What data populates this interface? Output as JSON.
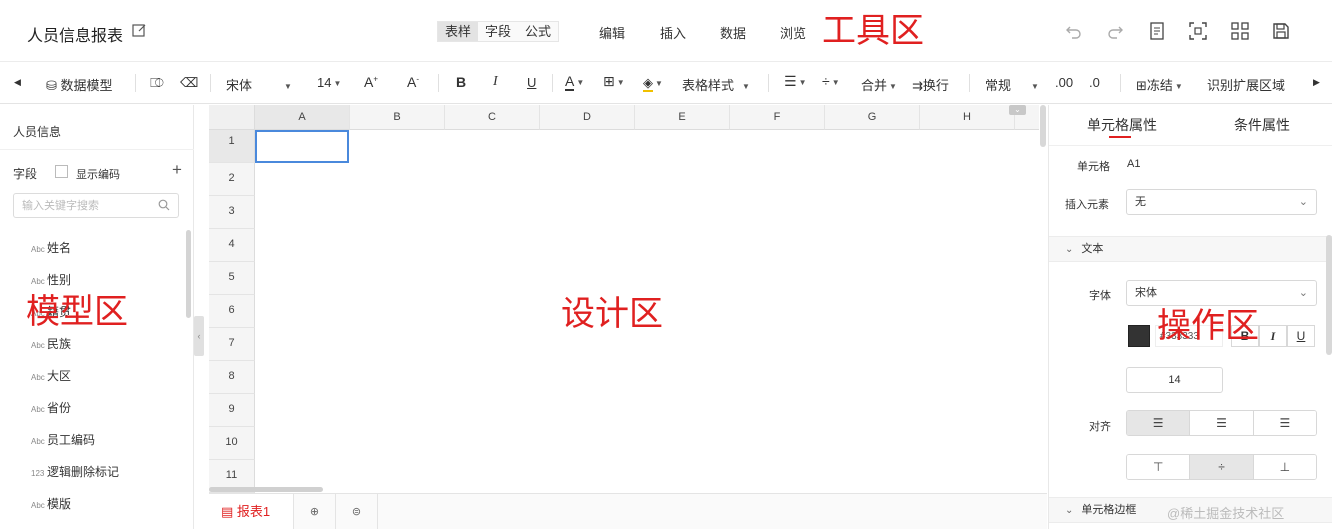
{
  "header": {
    "title": "人员信息报表",
    "mode_tabs": [
      "表样",
      "字段",
      "公式"
    ],
    "active_mode": "表样",
    "menus": [
      "编辑",
      "插入",
      "数据",
      "浏览"
    ],
    "toolbar_area_label": "工具区"
  },
  "toolbar": {
    "data_model": "数据模型",
    "font": "宋体",
    "font_size": "14",
    "table_style": "表格样式",
    "merge": "合并",
    "wrap": "换行",
    "number_format": "常规",
    "decimal_inc": ".00",
    "decimal_dec": ".0",
    "freeze": "冻结",
    "identify_range": "识别扩展区域"
  },
  "left": {
    "model_title": "人员信息",
    "field_label": "字段",
    "show_code": "显示编码",
    "search_placeholder": "输入关键字搜索",
    "area_label": "模型区",
    "fields": [
      {
        "type": "Abc",
        "name": "姓名"
      },
      {
        "type": "Abc",
        "name": "性别"
      },
      {
        "type": "Abc",
        "name": "籍贯"
      },
      {
        "type": "Abc",
        "name": "民族"
      },
      {
        "type": "Abc",
        "name": "大区"
      },
      {
        "type": "Abc",
        "name": "省份"
      },
      {
        "type": "Abc",
        "name": "员工编码"
      },
      {
        "type": "123",
        "name": "逻辑删除标记"
      },
      {
        "type": "Abc",
        "name": "模版"
      }
    ]
  },
  "grid": {
    "columns": [
      "A",
      "B",
      "C",
      "D",
      "E",
      "F",
      "G",
      "H"
    ],
    "rows": [
      "1",
      "2",
      "3",
      "4",
      "5",
      "6",
      "7",
      "8",
      "9",
      "10",
      "11"
    ],
    "selected_cell": "A1",
    "area_label": "设计区"
  },
  "bottom": {
    "sheet_tab": "报表1"
  },
  "right": {
    "tab_cell": "单元格属性",
    "tab_condition": "条件属性",
    "cell_label": "单元格",
    "cell_value": "A1",
    "insert_label": "插入元素",
    "insert_value": "无",
    "text_section": "文本",
    "font_label": "字体",
    "font_value": "宋体",
    "color_hex": "#333333",
    "font_size": "14",
    "align_label": "对齐",
    "border_section": "单元格边框",
    "area_label": "操作区",
    "text_color": "#333333"
  },
  "watermark": "@稀土掘金技术社区",
  "colors": {
    "accent": "#e02020",
    "selection": "#4a89dc"
  }
}
